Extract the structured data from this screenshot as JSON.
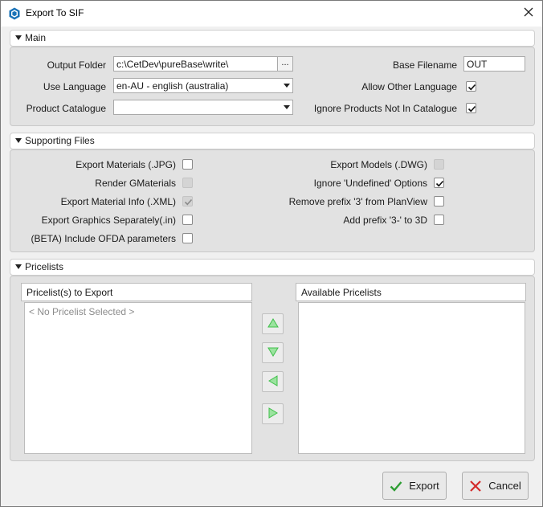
{
  "window": {
    "title": "Export To SIF",
    "icon": "app-hexagon-icon"
  },
  "main": {
    "header": "Main",
    "output_folder_label": "Output Folder",
    "output_folder_value": "c:\\CetDev\\pureBase\\write\\",
    "browse_label": "...",
    "use_language_label": "Use Language",
    "use_language_value": "en-AU - english (australia)",
    "product_catalogue_label": "Product Catalogue",
    "product_catalogue_value": "",
    "base_filename_label": "Base Filename",
    "base_filename_value": "OUT",
    "allow_other_language_label": "Allow Other Language",
    "allow_other_language_checked": true,
    "ignore_products_label": "Ignore Products Not In Catalogue",
    "ignore_products_checked": true
  },
  "supporting_files": {
    "header": "Supporting Files",
    "left": [
      {
        "label": "Export Materials (.JPG)",
        "checked": false,
        "enabled": true
      },
      {
        "label": "Render GMaterials",
        "checked": false,
        "enabled": false
      },
      {
        "label": "Export Material Info (.XML)",
        "checked": true,
        "enabled": false
      },
      {
        "label": "Export Graphics Separately(.in)",
        "checked": false,
        "enabled": true
      },
      {
        "label": "(BETA) Include OFDA parameters",
        "checked": false,
        "enabled": true
      }
    ],
    "right": [
      {
        "label": "Export Models (.DWG)",
        "checked": false,
        "enabled": false
      },
      {
        "label": "Ignore 'Undefined' Options",
        "checked": true,
        "enabled": true
      },
      {
        "label": "Remove prefix '3' from PlanView",
        "checked": false,
        "enabled": true
      },
      {
        "label": "Add prefix '3-' to 3D",
        "checked": false,
        "enabled": true
      }
    ]
  },
  "pricelists": {
    "header": "Pricelists",
    "to_export_header": "Pricelist(s) to Export",
    "to_export_placeholder": "< No Pricelist Selected >",
    "available_header": "Available Pricelists"
  },
  "buttons": {
    "export_label": "Export",
    "cancel_label": "Cancel"
  },
  "colors": {
    "arrow_green": "#3fbf4a",
    "check_green": "#2e9e34",
    "cancel_red": "#d42b2b",
    "section_bg": "#e2e2e2"
  }
}
